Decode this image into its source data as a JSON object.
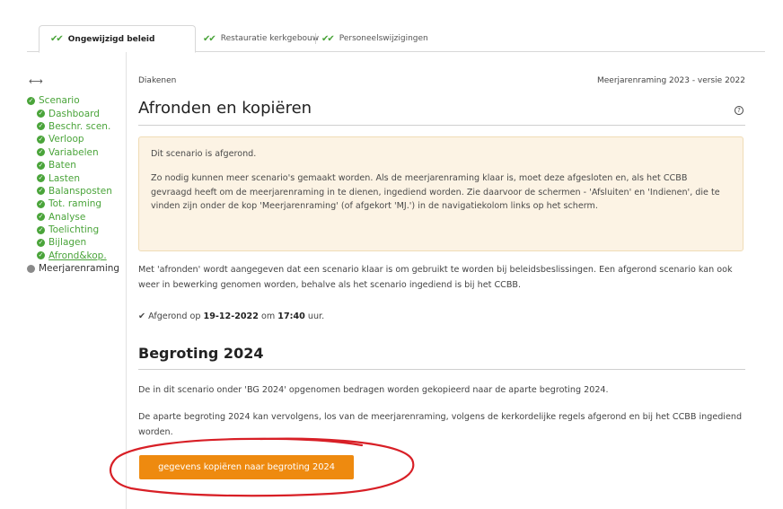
{
  "tabs": [
    {
      "label": "Ongewijzigd beleid",
      "check": "✔✔",
      "active": true
    },
    {
      "label": "Restauratie kerkgebouw",
      "check": "✔✔",
      "active": false
    },
    {
      "label": "Personeelswijzigingen",
      "check": "✔✔",
      "active": false
    }
  ],
  "sidebar": {
    "resize_glyph": "⟷",
    "items": [
      {
        "label": "Scenario",
        "level": 0,
        "status": "done"
      },
      {
        "label": "Dashboard",
        "level": 1,
        "status": "done"
      },
      {
        "label": "Beschr. scen.",
        "level": 1,
        "status": "done"
      },
      {
        "label": "Verloop",
        "level": 1,
        "status": "done"
      },
      {
        "label": "Variabelen",
        "level": 1,
        "status": "done"
      },
      {
        "label": "Baten",
        "level": 1,
        "status": "done"
      },
      {
        "label": "Lasten",
        "level": 1,
        "status": "done"
      },
      {
        "label": "Balansposten",
        "level": 1,
        "status": "done"
      },
      {
        "label": "Tot. raming",
        "level": 1,
        "status": "done"
      },
      {
        "label": "Analyse",
        "level": 1,
        "status": "done"
      },
      {
        "label": "Toelichting",
        "level": 1,
        "status": "done"
      },
      {
        "label": "Bijlagen",
        "level": 1,
        "status": "done"
      },
      {
        "label": "Afrond&kop.",
        "level": 1,
        "status": "done",
        "current": true
      },
      {
        "label": "Meerjarenraming",
        "level": 0,
        "status": "neutral"
      }
    ]
  },
  "main": {
    "breadcrumb": "Diakenen",
    "version": "Meerjarenraming 2023 - versie 2022",
    "title": "Afronden en kopiëren",
    "help_glyph": "?",
    "notice": {
      "line1": "Dit scenario is afgerond.",
      "line2": "Zo nodig kunnen meer scenario's gemaakt worden. Als de meerjarenraming klaar is, moet deze afgesloten en, als het CCBB gevraagd heeft om de meerjarenraming in te dienen, ingediend worden. Zie daarvoor de schermen - 'Afsluiten' en 'Indienen', die te vinden zijn onder de kop 'Meerjarenraming' (of afgekort 'MJ.') in de navigatiekolom links op het scherm."
    },
    "para1": "Met 'afronden' wordt aangegeven dat een scenario klaar is om gebruikt te worden bij beleidsbeslissingen. Een afgerond scenario kan ook weer in bewerking genomen worden, behalve als het scenario ingediend is bij het CCBB.",
    "done": {
      "check": "✔",
      "prefix": "Afgerond op",
      "date": "19-12-2022",
      "mid": "om",
      "time": "17:40",
      "suffix": "uur."
    },
    "section_title": "Begroting 2024",
    "para2": "De in dit scenario onder 'BG 2024' opgenomen bedragen worden gekopieerd naar de aparte begroting 2024.",
    "para3": "De aparte begroting 2024 kan vervolgens, los van de meerjarenraming, volgens de kerkordelijke regels afgerond en bij het CCBB ingediend worden.",
    "copy_button": "gegevens kopiëren naar begroting 2024"
  },
  "colors": {
    "accent_green": "#4aa43a",
    "button_orange": "#ee8a0f",
    "notice_bg": "#fcf3e4",
    "annotation_red": "#d81f26"
  },
  "icons": {
    "tab_check": "double-check-icon",
    "nav_status": "check-circle-icon",
    "help": "question-circle-icon",
    "resize": "horizontal-resize-icon"
  }
}
